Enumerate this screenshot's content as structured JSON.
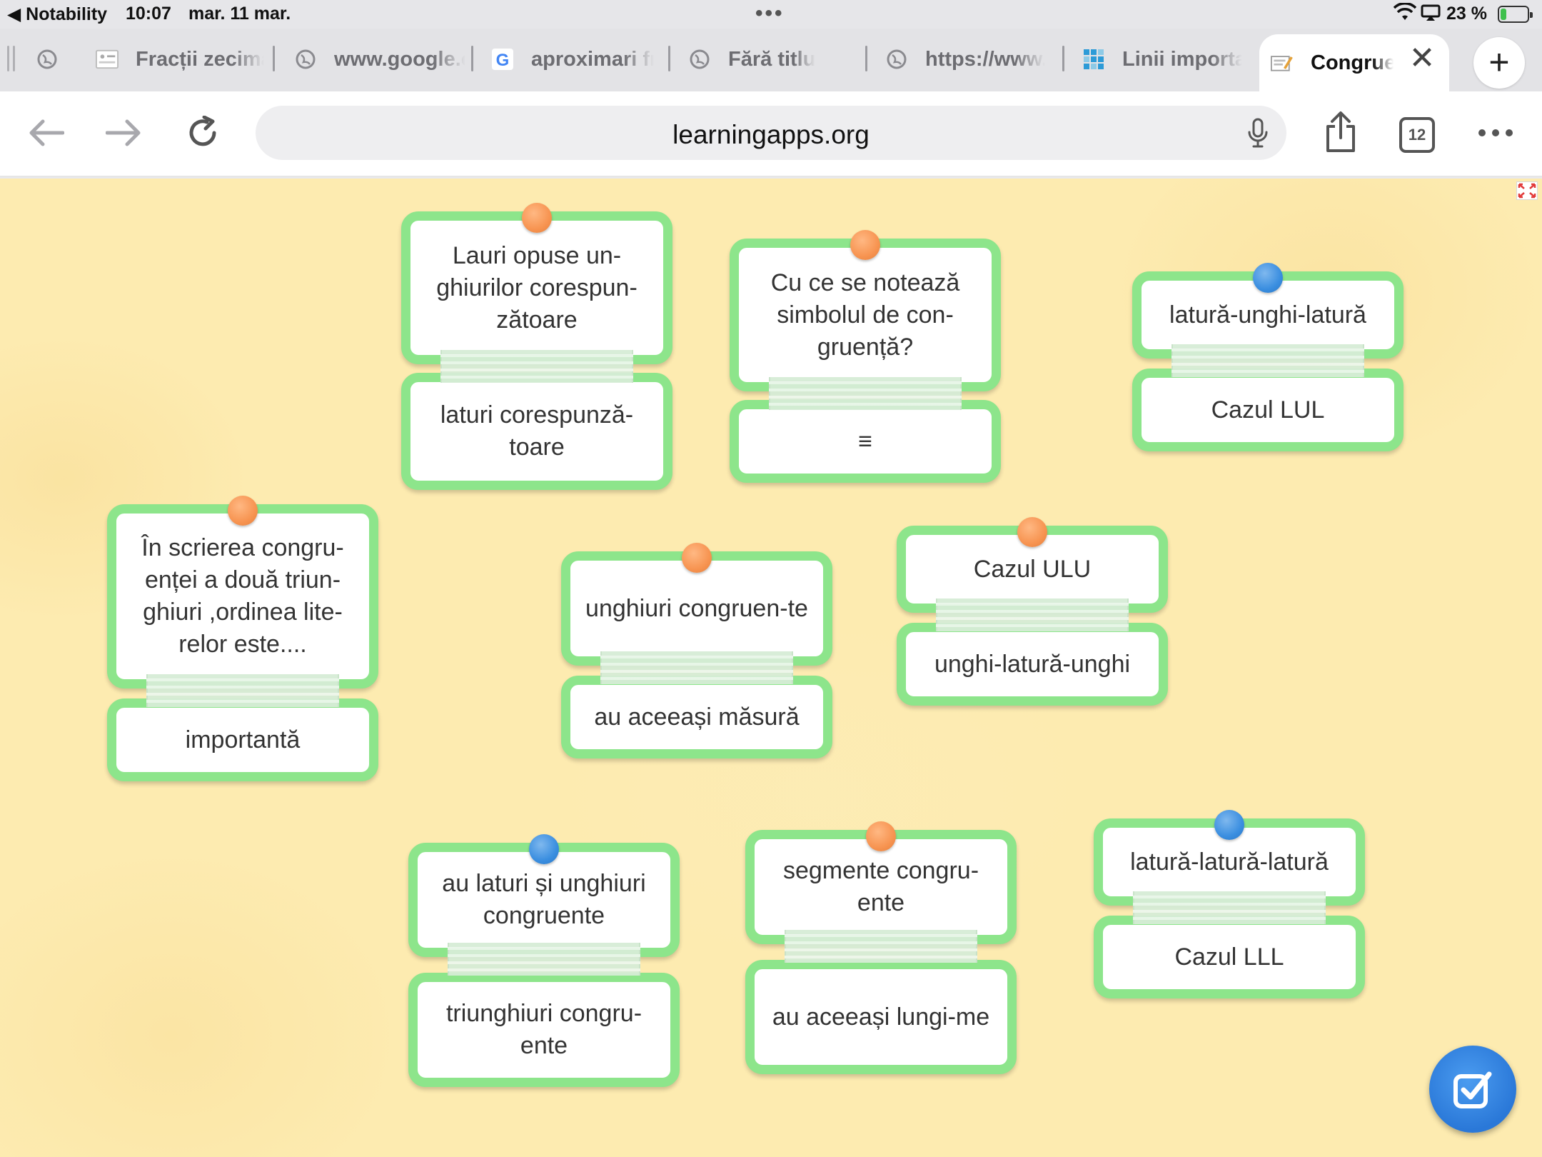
{
  "status_bar": {
    "back_app": "◀ Notability",
    "time": "10:07",
    "date": "mar. 11 mar.",
    "battery": "23 %",
    "battery_level": 0.23
  },
  "tabs": [
    {
      "title": "Fracții zecimale",
      "icon": "image-favicon-icon"
    },
    {
      "title": "www.google.com",
      "icon": "globe-icon"
    },
    {
      "title": "aproximari fracții",
      "icon": "google-icon"
    },
    {
      "title": "Fără titlu",
      "icon": "globe-icon"
    },
    {
      "title": "https://www.",
      "icon": "globe-icon"
    },
    {
      "title": "Linii importante",
      "icon": "grid-favicon-icon"
    },
    {
      "title": "Congruența",
      "icon": "learningapps-favicon-icon",
      "active": true
    }
  ],
  "toolbar": {
    "url": "learningapps.org",
    "tab_count": "12"
  },
  "cards": [
    {
      "top": "Lauri opuse un-ghiurilor corespun-zătoare",
      "bottom": "laturi corespunză-toare",
      "pin": "orange"
    },
    {
      "top": "Cu ce se notează simbolul de con-gruență?",
      "bottom": "≡",
      "pin": "orange"
    },
    {
      "top": "latură-unghi-latură",
      "bottom": "Cazul LUL",
      "pin": "blue"
    },
    {
      "top": "În scrierea congru-enței a două triun-ghiuri ,ordinea lite-relor este....",
      "bottom": "importantă",
      "pin": "orange"
    },
    {
      "top": "unghiuri congruen-te",
      "bottom": "au aceeași măsură",
      "pin": "orange"
    },
    {
      "top": "Cazul ULU",
      "bottom": "unghi-latură-unghi",
      "pin": "orange"
    },
    {
      "top": "au laturi și unghiuri congruente",
      "bottom": "triunghiuri congru-ente",
      "pin": "blue"
    },
    {
      "top": "segmente congru-ente",
      "bottom": "au aceeași lungi-me",
      "pin": "orange"
    },
    {
      "top": "latură-latură-latură",
      "bottom": "Cazul LLL",
      "pin": "blue"
    }
  ],
  "colors": {
    "card_border": "#8de58b",
    "background": "#fdebb0",
    "pin_orange": "#f79451",
    "pin_blue": "#3a8ee0",
    "check_button": "#2a78d8"
  }
}
